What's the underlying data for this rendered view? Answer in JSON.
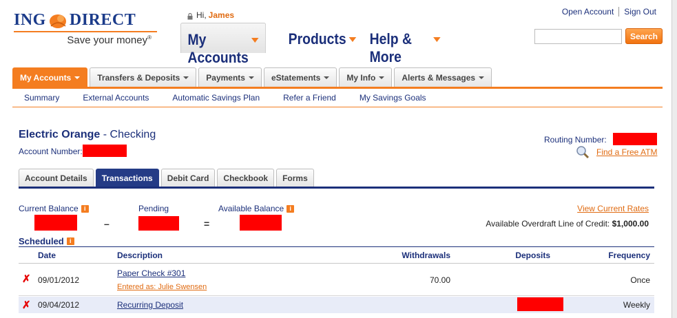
{
  "brand": {
    "logo_left": "ING",
    "logo_right": "DIRECT",
    "tagline": "Save your money",
    "tagline_mark": "®"
  },
  "greeting": {
    "prefix": "Hi,",
    "name": "James"
  },
  "main_nav": [
    {
      "label": "My Accounts"
    },
    {
      "label": "Products"
    },
    {
      "label": "Help & More"
    }
  ],
  "top_links": {
    "open_account": "Open Account",
    "sign_out": "Sign Out"
  },
  "search": {
    "value": "",
    "button": "Search"
  },
  "sub_tabs": [
    {
      "label": "My Accounts"
    },
    {
      "label": "Transfers & Deposits"
    },
    {
      "label": "Payments"
    },
    {
      "label": "eStatements"
    },
    {
      "label": "My Info"
    },
    {
      "label": "Alerts & Messages"
    }
  ],
  "sub_links": [
    "Summary",
    "External Accounts",
    "Automatic Savings Plan",
    "Refer a Friend",
    "My Savings Goals"
  ],
  "account": {
    "name": "Electric Orange",
    "type": "- Checking",
    "number_label": "Account Number:",
    "routing_label": "Routing Number:",
    "find_atm": "Find a Free ATM"
  },
  "account_tabs": [
    "Account Details",
    "Transactions",
    "Debit Card",
    "Checkbook",
    "Forms"
  ],
  "balances": {
    "current": "Current Balance",
    "pending": "Pending",
    "available": "Available Balance",
    "minus": "–",
    "equals": "=",
    "view_rates": "View Current Rates",
    "overdraft_label": "Available Overdraft Line of Credit:",
    "overdraft_value": "$1,000.00"
  },
  "scheduled": {
    "title": "Scheduled",
    "columns": {
      "date": "Date",
      "description": "Description",
      "withdrawals": "Withdrawals",
      "deposits": "Deposits",
      "frequency": "Frequency"
    },
    "rows": [
      {
        "date": "09/01/2012",
        "description": "Paper Check #301",
        "note": "Entered as: Julie Swensen",
        "withdrawal": "70.00",
        "frequency": "Once"
      },
      {
        "date": "09/04/2012",
        "description": "Recurring Deposit",
        "withdrawal": "",
        "frequency": "Weekly"
      }
    ]
  },
  "colors": {
    "orange": "#f47d20",
    "navy": "#1b2f7a",
    "redaction": "#ff0000"
  },
  "icons": [
    "lion-icon",
    "lock-icon",
    "info-icon",
    "magnifier-icon",
    "delete-x-icon"
  ]
}
